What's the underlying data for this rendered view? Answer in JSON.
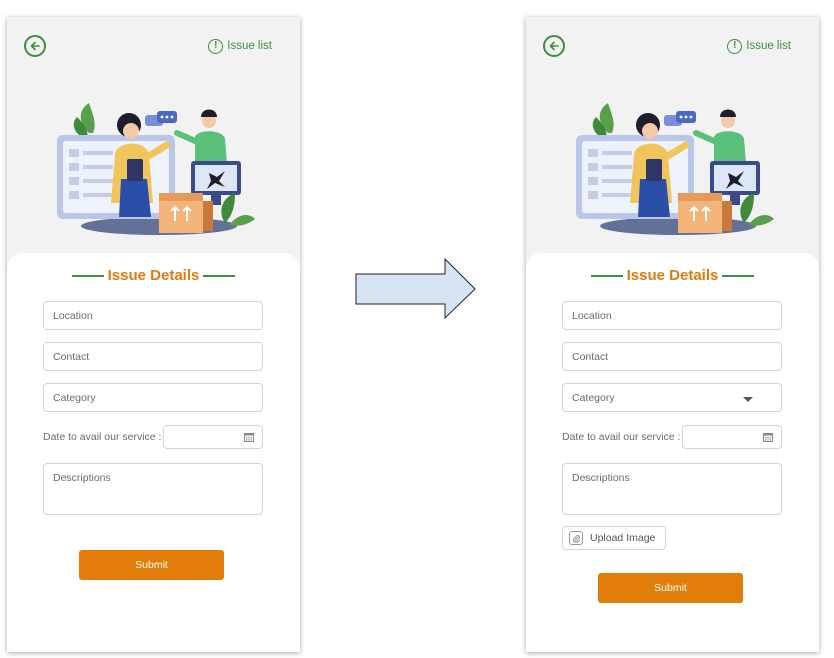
{
  "screens": {
    "before": {
      "header": {
        "issue_list_label": "Issue list"
      },
      "form": {
        "title": "Issue Details",
        "location_placeholder": "Location",
        "contact_placeholder": "Contact",
        "category_placeholder": "Category",
        "date_label": "Date to avail our service :",
        "descriptions_placeholder": "Descriptions",
        "submit_label": "Submit"
      }
    },
    "after": {
      "header": {
        "issue_list_label": "Issue list"
      },
      "form": {
        "title": "Issue Details",
        "location_placeholder": "Location",
        "contact_placeholder": "Contact",
        "category_placeholder": "Category",
        "category_has_dropdown": true,
        "date_label": "Date to avail our service :",
        "descriptions_placeholder": "Descriptions",
        "upload_label": "Upload Image",
        "submit_label": "Submit"
      }
    }
  },
  "icons": {
    "back": "back-arrow-circle-icon",
    "issue_list": "exclamation-circle-icon",
    "calendar": "calendar-icon",
    "attachment": "paperclip-icon",
    "dropdown": "chevron-down-icon",
    "transition": "right-arrow-icon"
  },
  "colors": {
    "accent_green": "#3d8f3d",
    "accent_orange": "#e07a10",
    "submit_bg": "#e27d0a",
    "arrow_fill": "#d6e4f3"
  }
}
